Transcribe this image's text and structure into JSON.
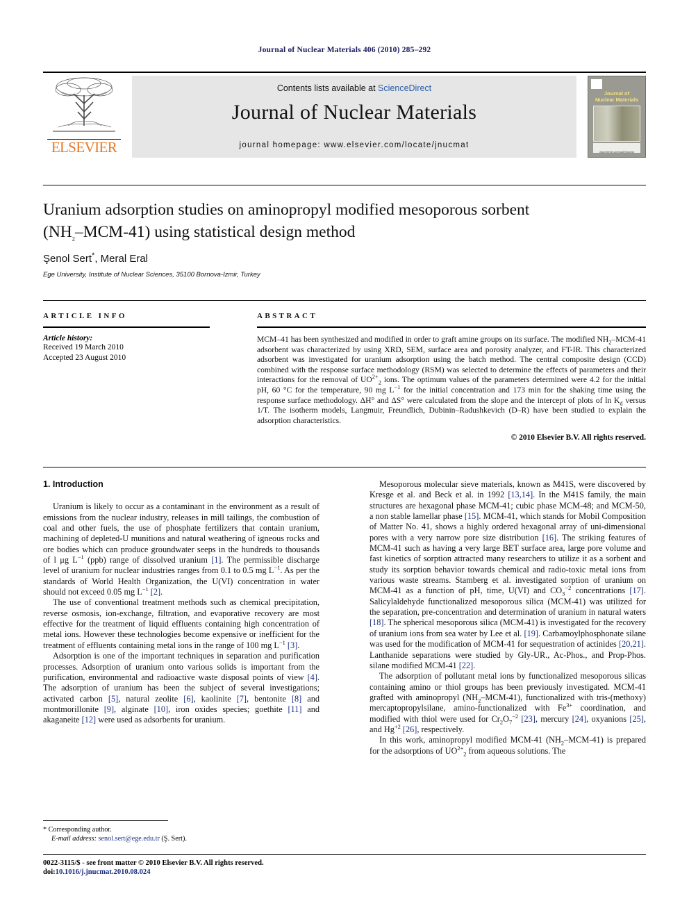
{
  "running_head": "Journal of Nuclear Materials 406 (2010) 285–292",
  "masthead": {
    "contents_line_prefix": "Contents lists available at ",
    "sciencedirect": "ScienceDirect",
    "journal_name": "Journal of Nuclear Materials",
    "homepage": "journal homepage: www.elsevier.com/locate/jnucmat",
    "publisher": "ELSEVIER",
    "cover_title": "Journal of\nNuclear Materials",
    "cover_footnote": "www.elsevier.com/locate/jnucmat",
    "accent_link_color": "#2b5fa8",
    "publisher_color": "#E87722"
  },
  "article": {
    "title": "Uranium adsorption studies on aminopropyl modified mesoporous sorbent (NH2–MCM-41) using statistical design method",
    "title_line1": "Uranium adsorption studies on aminopropyl modified mesoporous sorbent",
    "title_line2_pre": "(NH",
    "title_line2_sub": "2",
    "title_line2_post": "–MCM-41) using statistical design method",
    "authors": "Şenol Sert",
    "authors_second": ", Meral Eral",
    "corresponding_marker": "*",
    "affiliation": "Ege University, Institute of Nuclear Sciences, 35100 Bornova-Izmir, Turkey"
  },
  "article_info": {
    "heading": "ARTICLE INFO",
    "history_label": "Article history:",
    "received": "Received 19 March 2010",
    "accepted": "Accepted 23 August 2010"
  },
  "abstract": {
    "heading": "ABSTRACT",
    "p1_a": "MCM–41 has been synthesized and modified in order to graft amine groups on its surface. The modified NH",
    "p1_b": "2",
    "p1_c": "–MCM-41 adsorbent was characterized by using XRD, SEM, surface area and porosity analyzer, and FT-IR. This characterized adsorbent was investigated for uranium adsorption using the batch method. The central composite design (CCD) combined with the response surface methodology (RSM) was selected to determine the effects of parameters and their interactions for the removal of UO",
    "p1_d": "2+",
    "p1_e": "2",
    "p1_f": " ions. The optimum values of the parameters determined were 4.2 for the initial pH, 60 °C for the temperature, 90 mg L",
    "p1_g": "−1",
    "p1_h": " for the initial concentration and 173 min for the shaking time using the response surface methodology. ΔH° and ΔS° were calculated from the slope and the intercept of plots of ln K",
    "p1_i": "d",
    "p1_j": " versus 1/T. The isotherm models, Langmuir, Freundlich, Dubinin–Radushkevich (D–R) have been studied to explain the adsorption characteristics.",
    "copyright": "© 2010 Elsevier B.V. All rights reserved."
  },
  "body": {
    "section_heading": "1. Introduction",
    "left_p1_a": "Uranium is likely to occur as a contaminant in the environment as a result of emissions from the nuclear industry, releases in mill tailings, the combustion of coal and other fuels, the use of phosphate fertilizers that contain uranium, machining of depleted-U munitions and natural weathering of igneous rocks and ore bodies which can produce groundwater seeps in the hundreds to thousands of l μg L",
    "left_p1_sup1": "−1",
    "left_p1_b": " (ppb) range of dissolved uranium ",
    "left_p1_ref1": "[1]",
    "left_p1_c": ". The permissible discharge level of uranium for nuclear industries ranges from 0.1 to 0.5 mg L",
    "left_p1_sup2": "−1",
    "left_p1_d": ". As per the standards of World Health Organization, the U(VI) concentration in water should not exceed 0.05 mg L",
    "left_p1_sup3": "−1",
    "left_p1_e": " ",
    "left_p1_ref2": "[2]",
    "left_p1_f": ".",
    "left_p2_a": "The use of conventional treatment methods such as chemical precipitation, reverse osmosis, ion-exchange, filtration, and evaporative recovery are most effective for the treatment of liquid effluents containing high concentration of metal ions. However these technologies become expensive or inefficient for the treatment of effluents containing metal ions in the range of 100 mg L",
    "left_p2_sup1": "−1",
    "left_p2_b": " ",
    "left_p2_ref1": "[3]",
    "left_p2_c": ".",
    "left_p3_a": "Adsorption is one of the important techniques in separation and purification processes. Adsorption of uranium onto various solids is important from the purification, environmental and radioactive waste disposal points of view ",
    "left_p3_ref1": "[4]",
    "left_p3_b": ". The adsorption of uranium has been the subject of several investigations; activated carbon ",
    "left_p3_ref2": "[5]",
    "left_p3_c": ", natural zeolite ",
    "left_p3_ref3": "[6]",
    "left_p3_d": ", kaolinite ",
    "left_p3_ref4": "[7]",
    "left_p3_e": ", bentonite ",
    "left_p3_ref5": "[8]",
    "left_p3_f": " and montmorillonite ",
    "left_p3_ref6": "[9]",
    "left_p3_g": ", alginate ",
    "left_p3_ref7": "[10]",
    "left_p3_h": ", iron oxides species; goethite ",
    "left_p3_ref8": "[11]",
    "left_p3_i": " and akaganeite ",
    "left_p3_ref9": "[12]",
    "left_p3_j": " were used as adsorbents for uranium.",
    "right_p1_a": "Mesoporous molecular sieve materials, known as M41S, were discovered by Kresge et al. and Beck et al. in 1992 ",
    "right_p1_ref1": "[13,14]",
    "right_p1_b": ". In the M41S family, the main structures are hexagonal phase MCM-41; cubic phase MCM-48; and MCM-50, a non stable lamellar phase ",
    "right_p1_ref2": "[15]",
    "right_p1_c": ". MCM-41, which stands for Mobil Composition of Matter No. 41, shows a highly ordered hexagonal array of uni-dimensional pores with a very narrow pore size distribution ",
    "right_p1_ref3": "[16]",
    "right_p1_d": ". The striking features of MCM-41 such as having a very large BET surface area, large pore volume and fast kinetics of sorption attracted many researchers to utilize it as a sorbent and study its sorption behavior towards chemical and radio-toxic metal ions from various waste streams. Stamberg et al. investigated sorption of uranium on MCM-41 as a function of pH, time, U(VI) and CO",
    "right_p1_sub1": "3",
    "right_p1_sup1": "−2",
    "right_p1_e": " concentrations ",
    "right_p1_ref4": "[17]",
    "right_p1_f": ". Salicylaldehyde functionalized mesoporous silica (MCM-41) was utilized for the separation, pre-concentration and determination of uranium in natural waters ",
    "right_p1_ref5": "[18]",
    "right_p1_g": ". The spherical mesoporous silica (MCM-41) is investigated for the recovery of uranium ions from sea water by Lee et al. ",
    "right_p1_ref6": "[19]",
    "right_p1_h": ". Carbamoylphosphonate silane was used for the modification of MCM-41 for sequestration of actinides ",
    "right_p1_ref7": "[20,21]",
    "right_p1_i": ". Lanthanide separations were studied by Gly-UR., Ac-Phos., and Prop-Phos. silane modified MCM-41 ",
    "right_p1_ref8": "[22]",
    "right_p1_j": ".",
    "right_p2_a": "The adsorption of pollutant metal ions by functionalized mesoporous silicas containing amino or thiol groups has been previously investigated. MCM-41 grafted with aminopropyl (NH",
    "right_p2_sub1": "2",
    "right_p2_b": "–MCM-41), functionalized with tris-(methoxy) mercaptopropylsilane, amino-functionalized with Fe",
    "right_p2_sup1": "3+",
    "right_p2_c": " coordination, and modified with thiol were used for Cr",
    "right_p2_sub2": "2",
    "right_p2_d": "O",
    "right_p2_sub3": "7",
    "right_p2_sup2": "−2",
    "right_p2_e": " ",
    "right_p2_ref1": "[23]",
    "right_p2_f": ", mercury ",
    "right_p2_ref2": "[24]",
    "right_p2_g": ", oxyanions ",
    "right_p2_ref3": "[25]",
    "right_p2_h": ", and Hg",
    "right_p2_sup3": "+2",
    "right_p2_i": " ",
    "right_p2_ref4": "[26]",
    "right_p2_j": ", respectively.",
    "right_p3_a": "In this work, aminopropyl modified MCM-41 (NH",
    "right_p3_sub1": "2",
    "right_p3_b": "–MCM-41) is prepared for the adsorptions of UO",
    "right_p3_sup1": "2+",
    "right_p3_sub2": "2",
    "right_p3_c": " from aqueous solutions. The"
  },
  "footnotes": {
    "corresponding_marker": "*",
    "corresponding_text": "Corresponding author.",
    "email_label": "E-mail address:",
    "email": "senol.sert@ege.edu.tr",
    "email_suffix": "(Ş. Sert)."
  },
  "page_footer": {
    "issn_line": "0022-3115/$ - see front matter © 2010 Elsevier B.V. All rights reserved.",
    "doi_label": "doi:",
    "doi_value": "10.1016/j.jnucmat.2010.08.024"
  }
}
